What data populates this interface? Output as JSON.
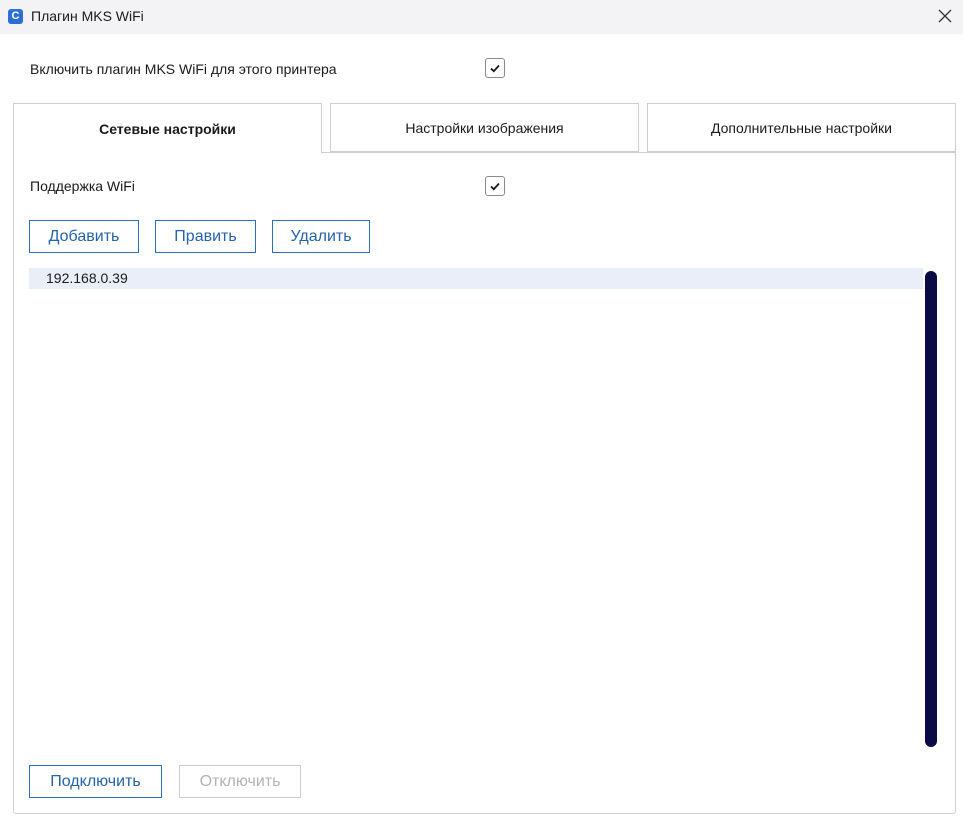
{
  "window": {
    "title": "Плагин MKS WiFi",
    "app_icon_letter": "C",
    "app_icon": "app-logo-icon",
    "close_icon": "close-icon"
  },
  "enable_plugin": {
    "label": "Включить плагин MKS WiFi для этого принтера",
    "checked": true
  },
  "tabs": [
    {
      "label": "Сетевые настройки",
      "active": true
    },
    {
      "label": "Настройки изображения",
      "active": false
    },
    {
      "label": "Дополнительные настройки",
      "active": false
    }
  ],
  "network": {
    "wifi_support_label": "Поддержка WiFi",
    "wifi_support_checked": true,
    "add_label": "Добавить",
    "edit_label": "Править",
    "delete_label": "Удалить",
    "printers": [
      "192.168.0.39"
    ],
    "connect_label": "Подключить",
    "disconnect_label": "Отключить"
  },
  "colors": {
    "accent": "#2b6fb6",
    "selection": "#e9eef9",
    "scrollbar": "#0a0a45",
    "titlebar": "#f3f3f6"
  }
}
